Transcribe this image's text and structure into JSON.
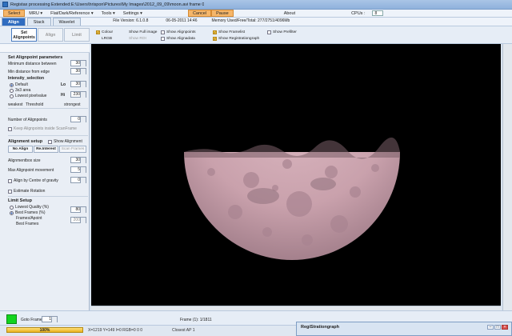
{
  "window": {
    "title": "Registax processing Extended:E:\\Users\\hrispon\\Pictures\\My Images\\2012_09_09\\moon.avi frame 0"
  },
  "menubar": {
    "items": [
      "Select",
      "MRU ▾",
      "Flat/Dark/Reference ▾",
      "Tools ▾",
      "Settings ▾"
    ],
    "cancel": "Cancel",
    "pause": "Pause",
    "about": "About",
    "cpus_label": "CPUs :",
    "cpus_value": "8"
  },
  "tabs": {
    "items": [
      "Align",
      "Stack",
      "Wavelet"
    ],
    "active": "Align",
    "file_version": "File Version: 6.1.0.8",
    "date": "06-05-2011 14:46",
    "memory": "Memory Used/Free/Total: 277/2751/4096Mb"
  },
  "align_subtabs": {
    "set_alignpoints": "Set Alignpoints",
    "align": "Align",
    "limit": "Limit"
  },
  "options": {
    "colour": "Colour",
    "lrgb": "LRGB",
    "show_full_image": "Show Full image",
    "show_roi": "Show ROI",
    "show_alignpoints": "Show Alignpoints",
    "show_alignadata": "Show Alignadata",
    "show_framelist": "Show Framelist",
    "show_registrationgraph": "Show Registrationgraph",
    "show_prefilter": "Show Prefilter"
  },
  "alignpoint_params": {
    "title": "Set Alignpoint parameters",
    "min_distance_label": "Minimum distance between",
    "min_distance_value": "30",
    "min_dist_edge_label": "Min distance from edge",
    "min_dist_edge_value": "30",
    "intensity_label": "Intensity_selection",
    "default_label": "Default",
    "area_label": "3x3 area",
    "lowest_label": "Lowest pixelvalue",
    "lo_label": "Lo",
    "lo_value": "30",
    "hi_label": "Hi",
    "hi_value": "230",
    "weakest": "weakest",
    "threshold": "Threshold",
    "strongest": "strongest",
    "num_alignpoints_label": "Number of Alignpoints",
    "num_alignpoints_value": "0",
    "keep_alignpoints": "Keep Alignpoints inside ScanFrame"
  },
  "alignment_setup": {
    "title": "Alignment setup",
    "show_alignment": "Show Alignment",
    "no_align": "No Align",
    "re_interest": "Re.Interest",
    "scan_frames": "Scan Frames",
    "alignbox_label": "Alignmentbox size",
    "alignbox_value": "30",
    "max_move_label": "Max Alignpoint movement",
    "max_move_value": "5",
    "centre_gravity_label": "Align by Centre of gravity",
    "centre_gravity_value": "0",
    "estimate_rotation": "Estimate Rotation"
  },
  "limit_setup": {
    "title": "Limit Setup",
    "lowest_quality_label": "Lowest Quality (%)",
    "best_frames_pct_label": "Best Frames (%)",
    "best_frames_pct_value": "80",
    "frames_apoint_label": "Frames/Apoint",
    "best_frames_label": "Best Frames",
    "best_frames_value": "200"
  },
  "bottombar": {
    "goto_frame": "Goto Frame",
    "goto_value": "1",
    "frame_info": "Frame (1): 1/1811"
  },
  "statusbar": {
    "progress": "100%",
    "progress_fraction": 1.0,
    "coords": "X=1219 Y=149 I=0 RGB=0 0 0",
    "closest_ap": "Closest AP 1"
  },
  "regi_window": {
    "title": "RegiStrationgraph"
  },
  "colors": {
    "accent": "#2f6cc0",
    "select_orange": "#f5b66a",
    "green_swatch": "#12d41f",
    "moon": "#c9a1ac"
  }
}
